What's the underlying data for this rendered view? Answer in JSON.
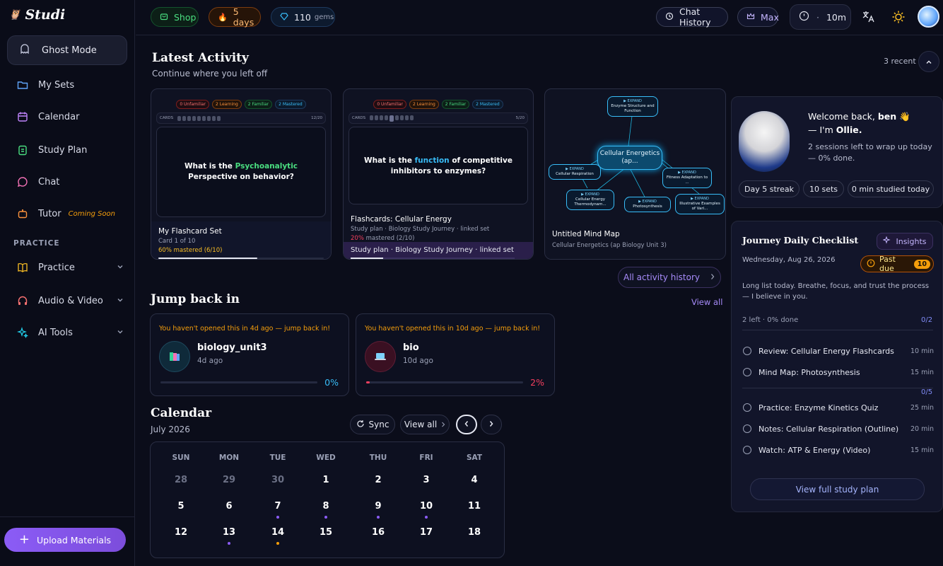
{
  "app": {
    "logo": "Studi"
  },
  "sidebar": {
    "ghost": "Ghost Mode",
    "items": [
      {
        "label": "My Sets"
      },
      {
        "label": "Calendar"
      },
      {
        "label": "Study Plan"
      },
      {
        "label": "Chat"
      },
      {
        "label": "Tutor",
        "badge": "Coming Soon"
      }
    ],
    "section": "PRACTICE",
    "groups": [
      {
        "label": "Practice"
      },
      {
        "label": "Audio & Video"
      },
      {
        "label": "AI Tools"
      }
    ],
    "upload": "Upload Materials"
  },
  "topbar": {
    "shop": "Shop",
    "streak": "5 days",
    "gems_count": "110",
    "gems_label": "gems",
    "chat_history": "Chat History",
    "plan": "Max",
    "timer_sep": "·",
    "timer": "10m"
  },
  "latest": {
    "title": "Latest Activity",
    "subtitle": "Continue where you left off",
    "recent": "3 recent",
    "cards": [
      {
        "chips": [
          "0 Unfamiliar",
          "2 Learning",
          "2 Familiar",
          "2 Mastered"
        ],
        "cards_label": "CARDS",
        "count": "12/20",
        "q_pre": "What is the ",
        "q_hl": "Psychoanalytic",
        "q_post": " Perspective on behavior?",
        "title": "My Flashcard Set",
        "line2": "Card 1 of 10",
        "mastered": "60% mastered (6/10)",
        "progress": 0.6
      },
      {
        "chips": [
          "0 Unfamiliar",
          "2 Learning",
          "2 Familiar",
          "2 Mastered"
        ],
        "cards_label": "CARDS",
        "count": "5/20",
        "q_pre": "What is the ",
        "q_hl": "function",
        "q_post": " of competitive inhibitors to enzymes?",
        "title": "Flashcards: Cellular Energy",
        "line2": "Study plan · Biology Study Journey · linked set",
        "mastered_pct": "20%",
        "mastered_rest": " mastered (2/10)",
        "footer": "Study plan · Biology Study Journey · linked set",
        "progress": 0.2
      },
      {
        "title": "Untitled Mind Map",
        "line2": "Cellular Energetics (ap Biology Unit 3)",
        "nodes": [
          {
            "ex": "▶ EXPAND",
            "t": "Enzyme Structure and Function"
          },
          {
            "ex": "",
            "t": "Cellular Energetics (ap..."
          },
          {
            "ex": "▶ EXPAND",
            "t": "Cellular Respiration"
          },
          {
            "ex": "▶ EXPAND",
            "t": "Fitness Adaptation to ..."
          },
          {
            "ex": "▶ EXPAND",
            "t": "Cellular Energy Thermodynam..."
          },
          {
            "ex": "▶ EXPAND",
            "t": "Photosynthesis"
          },
          {
            "ex": "▶ EXPAND",
            "t": "Illustrative Examples of Vari..."
          }
        ]
      }
    ],
    "all_history": "All activity history"
  },
  "jump": {
    "title": "Jump back in",
    "view_all": "View all",
    "items": [
      {
        "warn": "You haven't opened this in 4d ago — jump back in!",
        "name": "biology_unit3",
        "ago": "4d ago",
        "pct": "0%",
        "progress": 0
      },
      {
        "warn": "You haven't opened this in 10d ago — jump back in!",
        "name": "bio",
        "ago": "10d ago",
        "pct": "2%",
        "progress": 0.02
      }
    ]
  },
  "calendar": {
    "title": "Calendar",
    "month": "July 2026",
    "sync": "Sync",
    "view_all": "View all",
    "days": [
      "SUN",
      "MON",
      "TUE",
      "WED",
      "THU",
      "FRI",
      "SAT"
    ],
    "weeks": [
      [
        "28",
        "29",
        "30",
        "1",
        "2",
        "3",
        "4"
      ],
      [
        "5",
        "6",
        "7",
        "8",
        "9",
        "10",
        "11"
      ],
      [
        "12",
        "13",
        "14",
        "15",
        "16",
        "17",
        "18"
      ]
    ]
  },
  "welcome": {
    "hello": "Welcome back, ",
    "user": "ben",
    "wave": "👋",
    "im": "— I'm ",
    "bot": "Ollie.",
    "msg": "2 sessions left to wrap up today — 0% done.",
    "tags": [
      "Day 5 streak",
      "10 sets",
      "0 min studied today"
    ]
  },
  "checklist": {
    "title": "Journey Daily Checklist",
    "insights": "Insights",
    "date": "Wednesday, Aug 26, 2026",
    "past_due": "Past due",
    "past_due_count": "10",
    "note": "Long list today. Breathe, focus, and trust the process — I believe in you.",
    "progress_text": "2 left · 0% done",
    "g1_count": "0/2",
    "g2_count": "0/5",
    "tasks": [
      {
        "t": "Review: Cellular Energy Flashcards",
        "d": "10 min"
      },
      {
        "t": "Mind Map: Photosynthesis",
        "d": "15 min"
      },
      {
        "t": "Practice: Enzyme Kinetics Quiz",
        "d": "25 min"
      },
      {
        "t": "Notes: Cellular Respiration (Outline)",
        "d": "20 min"
      },
      {
        "t": "Watch: ATP & Energy (Video)",
        "d": "15 min"
      }
    ],
    "view_plan": "View full study plan"
  },
  "colors": {
    "accent": "#8b5cf6",
    "cyan": "#38bdf8",
    "amber": "#f59e0b",
    "green": "#22c55e",
    "red": "#f43f5e"
  }
}
